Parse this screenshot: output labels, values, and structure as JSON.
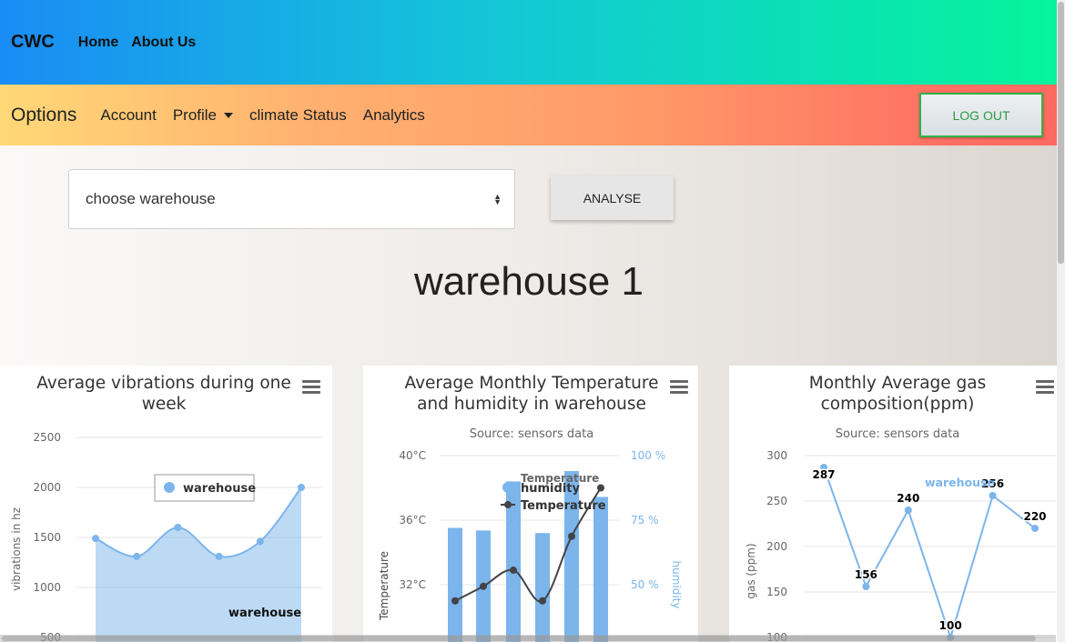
{
  "topbar": {
    "brand": "CWC",
    "links": [
      "Home",
      "About Us"
    ]
  },
  "optbar": {
    "title": "Options",
    "links": [
      "Account",
      "Profile",
      "climate Status",
      "Analytics"
    ],
    "logout": "LOG OUT"
  },
  "controls": {
    "select_value": "choose warehouse",
    "analyse_label": "ANALYSE"
  },
  "heading": "warehouse 1",
  "colors": {
    "series_blue": "#7cb5ec",
    "series_dark": "#434348",
    "logout_green": "#2fb34a"
  },
  "charts": [
    {
      "title": "Average vibrations during one week",
      "title_lines": [
        "Average vibrations during one",
        "week"
      ],
      "ylabel": "vibrations in hz",
      "yticks": [
        "2500",
        "2000",
        "1500",
        "1000",
        "500"
      ],
      "legend": "warehouse",
      "series_label": "warehouse",
      "icon": "menu-icon"
    },
    {
      "title": "Average Monthly Temperature and humidity in warehouse",
      "title_lines": [
        "Average Monthly Temperature",
        "and humidity in warehouse"
      ],
      "subtitle": "Source: sensors data",
      "ylabel_left": "Temperature",
      "ylabel_right": "humidity",
      "yticks_left": [
        "40°C",
        "36°C",
        "32°C"
      ],
      "yticks_right": [
        "100 %",
        "75 %",
        "50 %"
      ],
      "legend_items": [
        "humidity",
        "Temperature"
      ],
      "tooltip_series": "Temperature",
      "icon": "menu-icon"
    },
    {
      "title": "Monthly Average gas composition(ppm)",
      "title_lines": [
        "Monthly Average gas",
        "composition(ppm)"
      ],
      "subtitle": "Source: sensors data",
      "ylabel": "gas (ppm)",
      "yticks": [
        "300",
        "250",
        "200",
        "150",
        "100"
      ],
      "legend": "warehouse",
      "icon": "menu-icon"
    }
  ],
  "chart_data": [
    {
      "type": "area",
      "title": "Average vibrations during one week",
      "ylabel": "vibrations in hz",
      "ylim": [
        500,
        2500
      ],
      "series": [
        {
          "name": "warehouse",
          "values": [
            1490,
            1310,
            1600,
            1310,
            1460,
            2000
          ]
        }
      ]
    },
    {
      "type": "bar",
      "title": "Average Monthly Temperature and humidity in warehouse",
      "subtitle": "Source: sensors data",
      "ylabel": "Temperature",
      "ylim": [
        28,
        40
      ],
      "series": [
        {
          "name": "humidity",
          "type": "bar",
          "axis": "right",
          "values": [
            72,
            71,
            90,
            70,
            94,
            84
          ]
        },
        {
          "name": "Temperature",
          "type": "line",
          "axis": "left",
          "values": [
            31.0,
            31.9,
            32.9,
            31.0,
            35.0,
            38.0
          ]
        }
      ],
      "ylim_right": [
        25,
        100
      ],
      "ylabel_right": "humidity"
    },
    {
      "type": "line",
      "title": "Monthly Average gas composition(ppm)",
      "subtitle": "Source: sensors data",
      "ylabel": "gas (ppm)",
      "ylim": [
        100,
        300
      ],
      "series": [
        {
          "name": "warehouse",
          "values": [
            287,
            156,
            240,
            100,
            256,
            220
          ]
        }
      ]
    }
  ]
}
